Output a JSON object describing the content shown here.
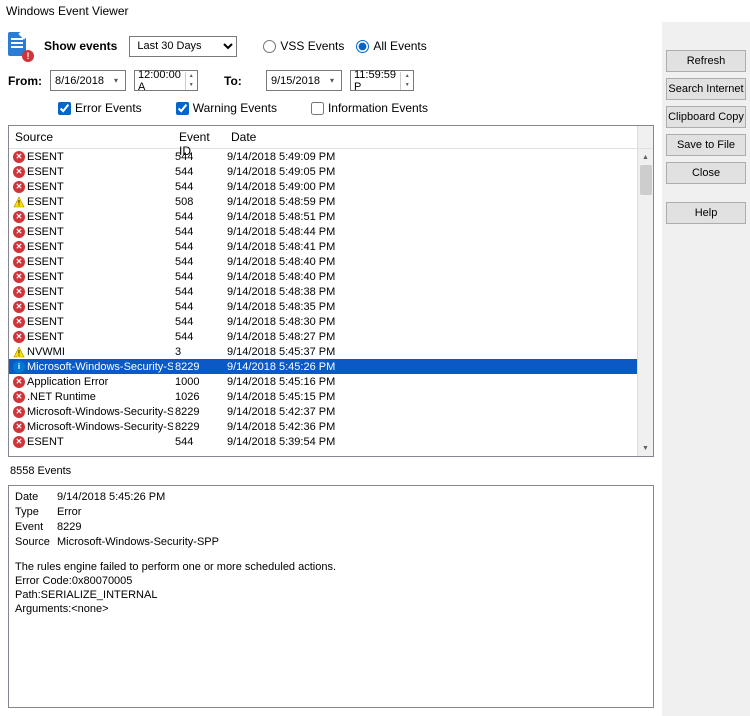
{
  "window_title": "Windows Event Viewer",
  "toolbar": {
    "show_events_label": "Show events",
    "range_options": [
      "Last 30 Days"
    ],
    "range_selected": "Last 30 Days",
    "vss_label": "VSS Events",
    "all_label": "All Events",
    "from_label": "From:",
    "from_date": "8/16/2018",
    "from_time": "12:00:00 A",
    "to_label": "To:",
    "to_date": "9/15/2018",
    "to_time": "11:59:59 P",
    "error_events_label": "Error Events",
    "warning_events_label": "Warning Events",
    "information_events_label": "Information Events"
  },
  "grid": {
    "headers": {
      "source": "Source",
      "event_id": "Event ID",
      "date": "Date"
    },
    "rows": [
      {
        "icon": "err",
        "source": "ESENT",
        "event_id": "544",
        "date": "9/14/2018 5:49:09 PM",
        "sel": false
      },
      {
        "icon": "err",
        "source": "ESENT",
        "event_id": "544",
        "date": "9/14/2018 5:49:05 PM",
        "sel": false
      },
      {
        "icon": "err",
        "source": "ESENT",
        "event_id": "544",
        "date": "9/14/2018 5:49:00 PM",
        "sel": false
      },
      {
        "icon": "warn",
        "source": "ESENT",
        "event_id": "508",
        "date": "9/14/2018 5:48:59 PM",
        "sel": false
      },
      {
        "icon": "err",
        "source": "ESENT",
        "event_id": "544",
        "date": "9/14/2018 5:48:51 PM",
        "sel": false
      },
      {
        "icon": "err",
        "source": "ESENT",
        "event_id": "544",
        "date": "9/14/2018 5:48:44 PM",
        "sel": false
      },
      {
        "icon": "err",
        "source": "ESENT",
        "event_id": "544",
        "date": "9/14/2018 5:48:41 PM",
        "sel": false
      },
      {
        "icon": "err",
        "source": "ESENT",
        "event_id": "544",
        "date": "9/14/2018 5:48:40 PM",
        "sel": false
      },
      {
        "icon": "err",
        "source": "ESENT",
        "event_id": "544",
        "date": "9/14/2018 5:48:40 PM",
        "sel": false
      },
      {
        "icon": "err",
        "source": "ESENT",
        "event_id": "544",
        "date": "9/14/2018 5:48:38 PM",
        "sel": false
      },
      {
        "icon": "err",
        "source": "ESENT",
        "event_id": "544",
        "date": "9/14/2018 5:48:35 PM",
        "sel": false
      },
      {
        "icon": "err",
        "source": "ESENT",
        "event_id": "544",
        "date": "9/14/2018 5:48:30 PM",
        "sel": false
      },
      {
        "icon": "err",
        "source": "ESENT",
        "event_id": "544",
        "date": "9/14/2018 5:48:27 PM",
        "sel": false
      },
      {
        "icon": "warn",
        "source": "NVWMI",
        "event_id": "3",
        "date": "9/14/2018 5:45:37 PM",
        "sel": false
      },
      {
        "icon": "info",
        "source": "Microsoft-Windows-Security-SPP",
        "event_id": "8229",
        "date": "9/14/2018 5:45:26 PM",
        "sel": true
      },
      {
        "icon": "err",
        "source": "Application Error",
        "event_id": "1000",
        "date": "9/14/2018 5:45:16 PM",
        "sel": false
      },
      {
        "icon": "err",
        "source": ".NET Runtime",
        "event_id": "1026",
        "date": "9/14/2018 5:45:15 PM",
        "sel": false
      },
      {
        "icon": "err",
        "source": "Microsoft-Windows-Security-SPP",
        "event_id": "8229",
        "date": "9/14/2018 5:42:37 PM",
        "sel": false
      },
      {
        "icon": "err",
        "source": "Microsoft-Windows-Security-SPP",
        "event_id": "8229",
        "date": "9/14/2018 5:42:36 PM",
        "sel": false
      },
      {
        "icon": "err",
        "source": "ESENT",
        "event_id": "544",
        "date": "9/14/2018 5:39:54 PM",
        "sel": false
      }
    ]
  },
  "status": "8558 Events",
  "details": {
    "date_k": "Date",
    "date_v": "9/14/2018 5:45:26 PM",
    "type_k": "Type",
    "type_v": "Error",
    "event_k": "Event",
    "event_v": "8229",
    "source_k": "Source",
    "source_v": "Microsoft-Windows-Security-SPP",
    "msg_line1": "The rules engine failed to perform one or more scheduled actions.",
    "msg_line2": "Error Code:0x80070005",
    "msg_line3": "Path:SERIALIZE_INTERNAL",
    "msg_line4": "Arguments:<none>"
  },
  "buttons": {
    "refresh": "Refresh",
    "search": "Search Internet",
    "clipboard": "Clipboard Copy",
    "save": "Save to File",
    "close": "Close",
    "help": "Help"
  }
}
